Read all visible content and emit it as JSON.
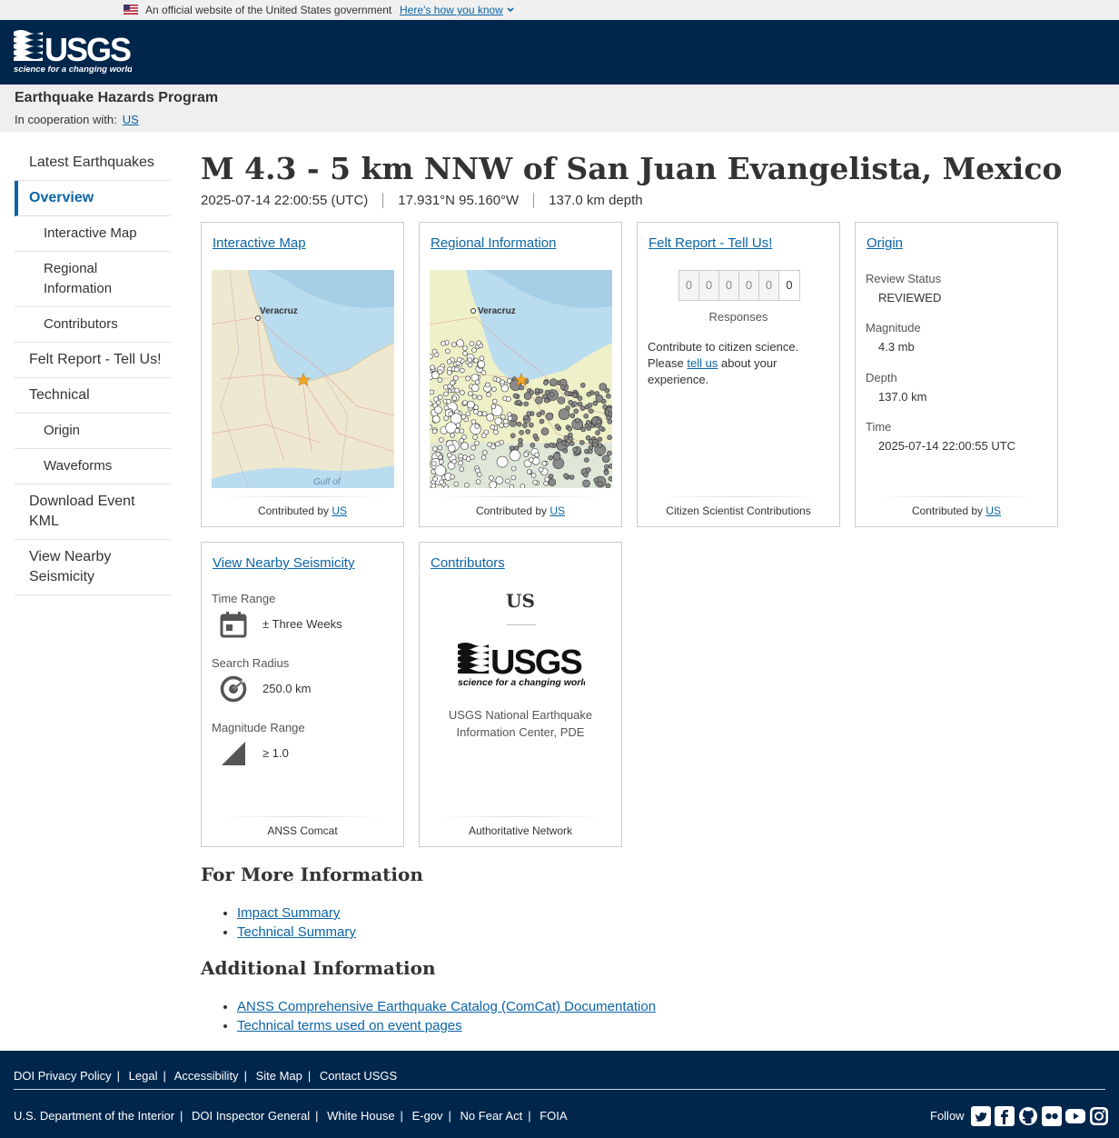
{
  "gov_banner": {
    "text": "An official website of the United States government",
    "how_link": "Here’s how you know"
  },
  "header": {
    "logo_text": "USGS",
    "logo_tagline": "science for a changing world"
  },
  "program": {
    "title": "Earthquake Hazards Program",
    "coop_label": "In cooperation with:",
    "coop_link": "US"
  },
  "sidebar": {
    "items": [
      {
        "label": "Latest Earthquakes"
      },
      {
        "label": "Overview"
      },
      {
        "label": "Interactive Map"
      },
      {
        "label": "Regional Information"
      },
      {
        "label": "Contributors"
      },
      {
        "label": "Felt Report - Tell Us!"
      },
      {
        "label": "Technical"
      },
      {
        "label": "Origin"
      },
      {
        "label": "Waveforms"
      },
      {
        "label": "Download Event KML"
      },
      {
        "label": "View Nearby Seismicity"
      }
    ]
  },
  "event": {
    "title": "M 4.3 - 5 km NNW of San Juan Evangelista, Mexico",
    "time": "2025-07-14 22:00:55 (UTC)",
    "location": "17.931°N 95.160°W",
    "depth": "137.0 km depth"
  },
  "cards": {
    "interactive_map": {
      "title": "Interactive Map",
      "foot_prefix": "Contributed by",
      "foot_link": "US",
      "city": "Veracruz",
      "gulf": "Gulf of"
    },
    "regional": {
      "title": "Regional Information",
      "foot_prefix": "Contributed by",
      "foot_link": "US",
      "city": "Veracruz"
    },
    "felt": {
      "title": "Felt Report - Tell Us!",
      "digits": [
        "0",
        "0",
        "0",
        "0",
        "0",
        "0"
      ],
      "responses": "Responses",
      "text_pre": "Contribute to citizen science. Please",
      "text_link": "tell us",
      "text_post": "about your experience.",
      "foot": "Citizen Scientist Contributions"
    },
    "origin": {
      "title": "Origin",
      "review_label": "Review Status",
      "review_value": "REVIEWED",
      "mag_label": "Magnitude",
      "mag_value": "4.3 mb",
      "depth_label": "Depth",
      "depth_value": "137.0 km",
      "time_label": "Time",
      "time_value": "2025-07-14 22:00:55 UTC",
      "foot_prefix": "Contributed by",
      "foot_link": "US"
    },
    "seismicity": {
      "title": "View Nearby Seismicity",
      "time_label": "Time Range",
      "time_value": "± Three Weeks",
      "radius_label": "Search Radius",
      "radius_value": "250.0 km",
      "mag_label": "Magnitude Range",
      "mag_value": "≥ 1.0",
      "foot": "ANSS Comcat"
    },
    "contributors": {
      "title": "Contributors",
      "network": "US",
      "logo_text": "USGS",
      "logo_tagline": "science for a changing world",
      "name_line1": "USGS National Earthquake",
      "name_line2": "Information Center, PDE",
      "foot": "Authoritative Network"
    }
  },
  "more_info": {
    "heading": "For More Information",
    "links": [
      "Impact Summary",
      "Technical Summary"
    ]
  },
  "additional": {
    "heading": "Additional Information",
    "links": [
      "ANSS Comprehensive Earthquake Catalog (ComCat) Documentation",
      "Technical terms used on event pages"
    ]
  },
  "footer": {
    "row1": [
      "DOI Privacy Policy",
      "Legal",
      "Accessibility",
      "Site Map",
      "Contact USGS"
    ],
    "row2": [
      "U.S. Department of the Interior",
      "DOI Inspector General",
      "White House",
      "E-gov",
      "No Fear Act",
      "FOIA"
    ],
    "follow": "Follow",
    "socials": [
      "twitter-icon",
      "facebook-icon",
      "github-icon",
      "flickr-icon",
      "youtube-icon",
      "instagram-icon"
    ]
  },
  "colors": {
    "header_bg": "#00264c",
    "link": "#0b64a6",
    "quake_star": "#f5a623"
  }
}
